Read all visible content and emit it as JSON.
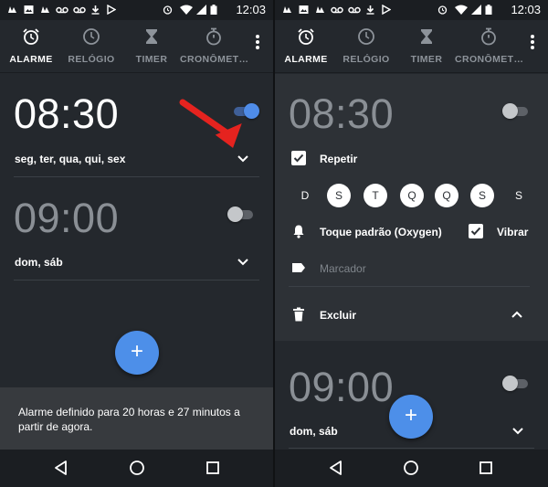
{
  "status_bar": {
    "time": "12:03"
  },
  "tabs": [
    {
      "label": "ALARME",
      "icon": "alarm-clock-icon",
      "active": true
    },
    {
      "label": "RELÓGIO",
      "icon": "clock-icon",
      "active": false
    },
    {
      "label": "TIMER",
      "icon": "hourglass-icon",
      "active": false
    },
    {
      "label": "CRONÔMET…",
      "icon": "stopwatch-icon",
      "active": false
    }
  ],
  "left_screen": {
    "alarms": [
      {
        "time": "08:30",
        "days": "seg, ter, qua, qui, sex",
        "enabled": true
      },
      {
        "time": "09:00",
        "days": "dom, sáb",
        "enabled": false
      }
    ],
    "snackbar": "Alarme definido para 20 horas e 27 minutos a partir de agora."
  },
  "right_screen": {
    "expanded_alarm": {
      "time": "08:30",
      "enabled": false,
      "repeat_label": "Repetir",
      "repeat_checked": true,
      "week_days": [
        {
          "letter": "D",
          "selected": false
        },
        {
          "letter": "S",
          "selected": true
        },
        {
          "letter": "T",
          "selected": true
        },
        {
          "letter": "Q",
          "selected": true
        },
        {
          "letter": "Q",
          "selected": true
        },
        {
          "letter": "S",
          "selected": true
        },
        {
          "letter": "S",
          "selected": false
        }
      ],
      "ringtone": "Toque padrão (Oxygen)",
      "vibrate_label": "Vibrar",
      "vibrate_checked": true,
      "label_placeholder": "Marcador",
      "delete_label": "Excluir"
    },
    "second_alarm": {
      "time": "09:00",
      "days": "dom, sáb",
      "enabled": false
    }
  },
  "fab_label": "+",
  "colors": {
    "accent": "#4d8fe9",
    "background": "#24282d",
    "expanded_bg": "#2d3136",
    "annotation_arrow": "#e5231f"
  }
}
